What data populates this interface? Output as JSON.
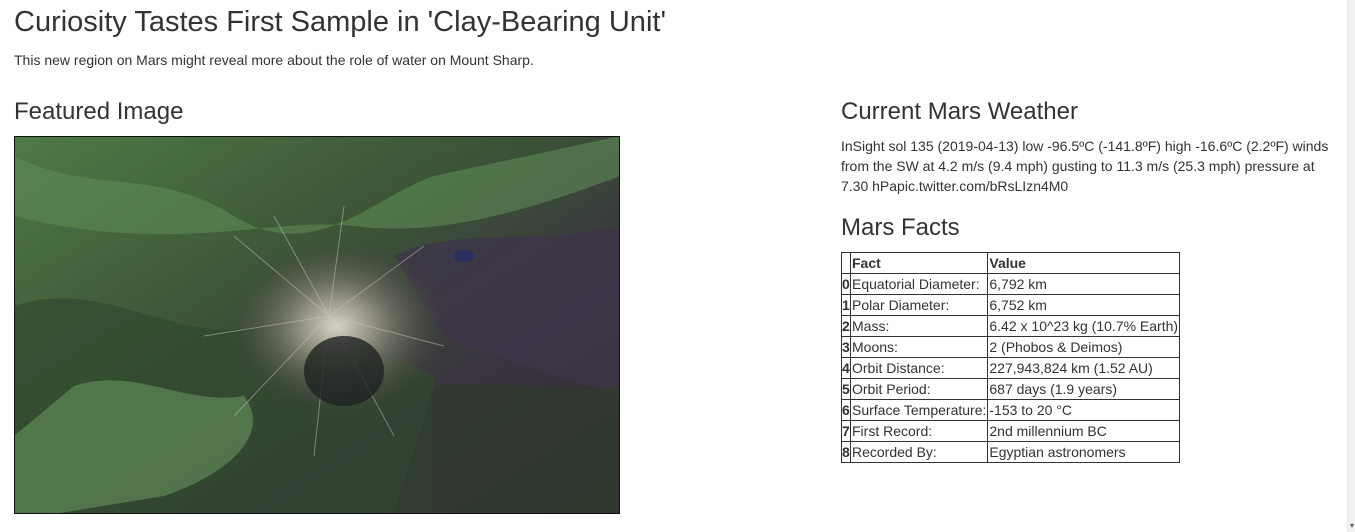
{
  "news": {
    "title": "Curiosity Tastes First Sample in 'Clay-Bearing Unit'",
    "teaser": "This new region on Mars might reveal more about the role of water on Mount Sharp."
  },
  "featured": {
    "heading": "Featured Image"
  },
  "weather": {
    "heading": "Current Mars Weather",
    "text": "InSight sol 135 (2019-04-13) low -96.5ºC (-141.8ºF) high -16.6ºC (2.2ºF) winds from the SW at 4.2 m/s (9.4 mph) gusting to 11.3 m/s (25.3 mph) pressure at 7.30 hPapic.twitter.com/bRsLIzn4M0"
  },
  "facts": {
    "heading": "Mars Facts",
    "columns": [
      "",
      "Fact",
      "Value"
    ],
    "rows": [
      {
        "idx": "0",
        "fact": "Equatorial Diameter:",
        "value": "6,792 km"
      },
      {
        "idx": "1",
        "fact": "Polar Diameter:",
        "value": "6,752 km"
      },
      {
        "idx": "2",
        "fact": "Mass:",
        "value": "6.42 x 10^23 kg (10.7% Earth)"
      },
      {
        "idx": "3",
        "fact": "Moons:",
        "value": "2 (Phobos & Deimos)"
      },
      {
        "idx": "4",
        "fact": "Orbit Distance:",
        "value": "227,943,824 km (1.52 AU)"
      },
      {
        "idx": "5",
        "fact": "Orbit Period:",
        "value": "687 days (1.9 years)"
      },
      {
        "idx": "6",
        "fact": "Surface Temperature:",
        "value": "-153 to 20 °C"
      },
      {
        "idx": "7",
        "fact": "First Record:",
        "value": "2nd millennium BC"
      },
      {
        "idx": "8",
        "fact": "Recorded By:",
        "value": "Egyptian astronomers"
      }
    ]
  }
}
